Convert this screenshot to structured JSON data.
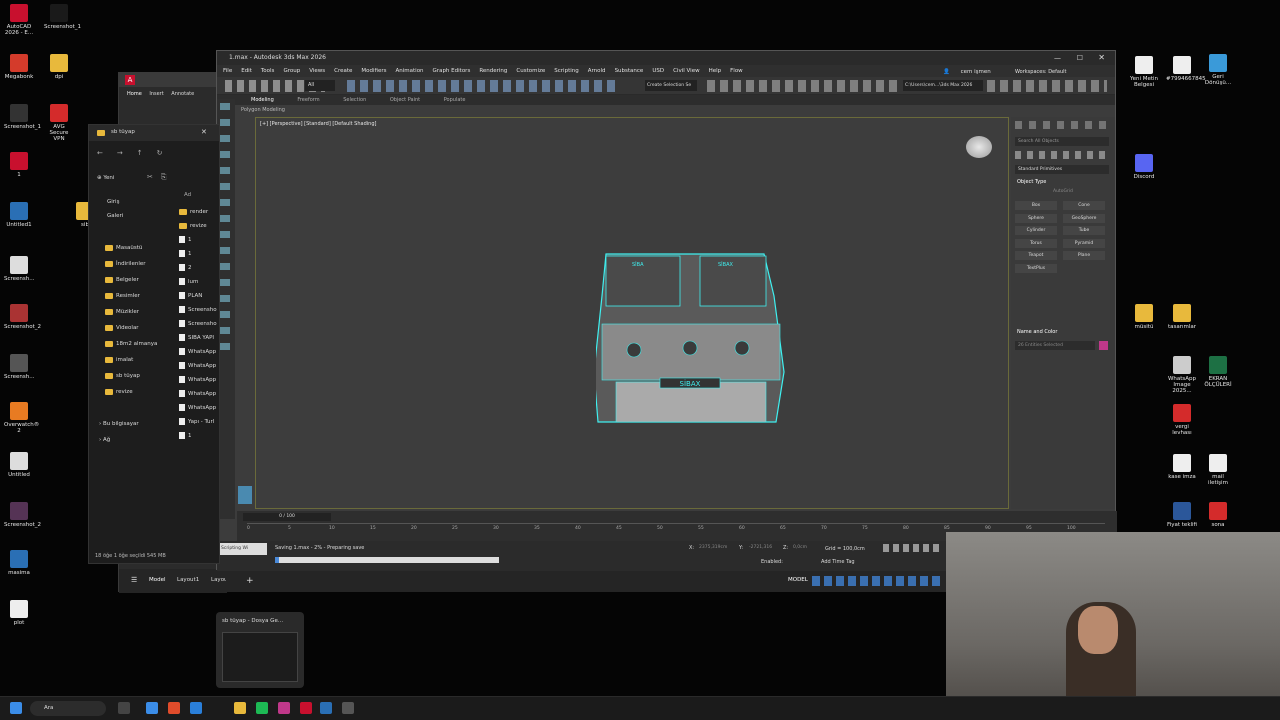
{
  "desktop_left": [
    {
      "label": "AutoCAD 2026 - E...",
      "color": "#c8102e"
    },
    {
      "label": "Screenshot_1",
      "color": "#1a1a1a"
    },
    {
      "label": "Megabonk",
      "color": "#d43b2b"
    },
    {
      "label": "dpi",
      "color": "#e8b93c"
    },
    {
      "label": "Screenshot_1",
      "color": "#333"
    },
    {
      "label": "AVG Secure VPN",
      "color": "#d42b2b"
    },
    {
      "label": "1",
      "color": "#c8102e"
    },
    {
      "label": "Untitled1",
      "color": "#2a6fb5"
    },
    {
      "label": "sib",
      "color": "#e8b93c"
    },
    {
      "label": "Screensh...",
      "color": "#ddd"
    },
    {
      "label": "Screenshot_2",
      "color": "#a33"
    },
    {
      "label": "Screensh...",
      "color": "#555"
    },
    {
      "label": "Overwatch® 2",
      "color": "#e87b22"
    },
    {
      "label": "Untitled",
      "color": "#ddd"
    },
    {
      "label": "Screenshot_2",
      "color": "#535"
    },
    {
      "label": "masima",
      "color": "#2a6fb5"
    },
    {
      "label": "plot",
      "color": "#eee"
    }
  ],
  "desktop_right": [
    {
      "label": "Yeni Metin Belgesi",
      "color": "#eee"
    },
    {
      "label": "#7994667845",
      "color": "#eee"
    },
    {
      "label": "Geri Dönüşü...",
      "color": "#3a9ad9"
    },
    {
      "label": "Discord",
      "color": "#5865f2"
    },
    {
      "label": "müsitü",
      "color": "#e8b93c"
    },
    {
      "label": "tasarımlar",
      "color": "#e8b93c"
    },
    {
      "label": "WhatsApp Image 2025...",
      "color": "#ccc"
    },
    {
      "label": "EKRAN ÖLÇÜLERİ",
      "color": "#1d7044"
    },
    {
      "label": "vergi levhası",
      "color": "#d42b2b"
    },
    {
      "label": "kase imza",
      "color": "#eee"
    },
    {
      "label": "mail iletişim",
      "color": "#eee"
    },
    {
      "label": "Fiyat teklifi",
      "color": "#2b579a"
    },
    {
      "label": "sona",
      "color": "#d42b2b"
    }
  ],
  "acad": {
    "tabs": [
      "Home",
      "Insert",
      "Annotate"
    ]
  },
  "explorer": {
    "title": "sb tüyap",
    "new_label": "Yeni",
    "nav": [
      "Giriş",
      "Galeri"
    ],
    "quick": [
      "Masaüstü",
      "İndirilenler",
      "Belgeler",
      "Resimler",
      "Müzikler",
      "Videolar",
      "18m2 almanya",
      "imalat",
      "sb tüyap",
      "revize"
    ],
    "tree": [
      "Bu bilgisayar",
      "Ağ"
    ],
    "col_header": "Ad",
    "files": [
      "render",
      "revize",
      "1",
      "1",
      "2",
      "lum",
      "PLAN",
      "Screensho",
      "Screensho",
      "SIBA YAPI",
      "WhatsApp",
      "WhatsApp",
      "WhatsApp",
      "WhatsApp",
      "WhatsApp",
      "Yapı - Turl",
      "1"
    ],
    "status": "18 öğe   1 öğe seçildi 545 MB"
  },
  "max": {
    "title": "1.max - Autodesk 3ds Max 2026",
    "menus": [
      "File",
      "Edit",
      "Tools",
      "Group",
      "Views",
      "Create",
      "Modifiers",
      "Animation",
      "Graph Editors",
      "Rendering",
      "Customize",
      "Scripting",
      "Arnold",
      "Substance",
      "USD",
      "Civil View",
      "Help",
      "Flow"
    ],
    "user": "cem işmen",
    "workspaces": "Workspaces: Default",
    "selection_set": "Create Selection Se",
    "path": "C:\\Users\\cem...\\3ds Max 2026",
    "all_filter": "All",
    "ribbon": [
      "Modeling",
      "Freeform",
      "Selection",
      "Object Paint",
      "Populate"
    ],
    "polygon_modeling": "Polygon Modeling",
    "viewport_label": "[+] [Perspective] [Standard] [Default Shading]",
    "search": "Search All Objects",
    "std_primitives": "Standard Primitives",
    "object_type": "Object Type",
    "autogrid": "AutoGrid",
    "primitives": [
      "Box",
      "Cone",
      "Sphere",
      "GeoSphere",
      "Cylinder",
      "Tube",
      "Torus",
      "Pyramid",
      "Teapot",
      "Plane",
      "TextPlus"
    ],
    "name_color": "Name and Color",
    "selected_placeholder": "26 Entities Selected",
    "frame": "0 / 100",
    "ticks": [
      "0",
      "5",
      "10",
      "15",
      "20",
      "25",
      "30",
      "35",
      "40",
      "45",
      "50",
      "55",
      "60",
      "65",
      "70",
      "75",
      "80",
      "85",
      "90",
      "95",
      "100"
    ],
    "saving": "Saving 1.max - 2% - Preparing save",
    "script": "Scripting Wi",
    "grid": "Grid = 100,0cm",
    "enabled": "Enabled:",
    "add_time_tag": "Add Time Tag",
    "x_label": "X:",
    "y_label": "Y:",
    "z_label": "Z:",
    "x_val": "2375,319cm",
    "y_val": "-2721,316",
    "z_val": "0,0cm"
  },
  "booth": {
    "sign_left": "SİBA",
    "sign_right": "SİBAX",
    "sign_front": "SİBAX"
  },
  "acad_bottom": {
    "tabs": [
      "Model",
      "Layout1",
      "Layout2"
    ],
    "model": "MODEL"
  },
  "preview": {
    "title": "sb tüyap - Dosya Ge..."
  },
  "taskbar": {
    "search": "Ara"
  }
}
